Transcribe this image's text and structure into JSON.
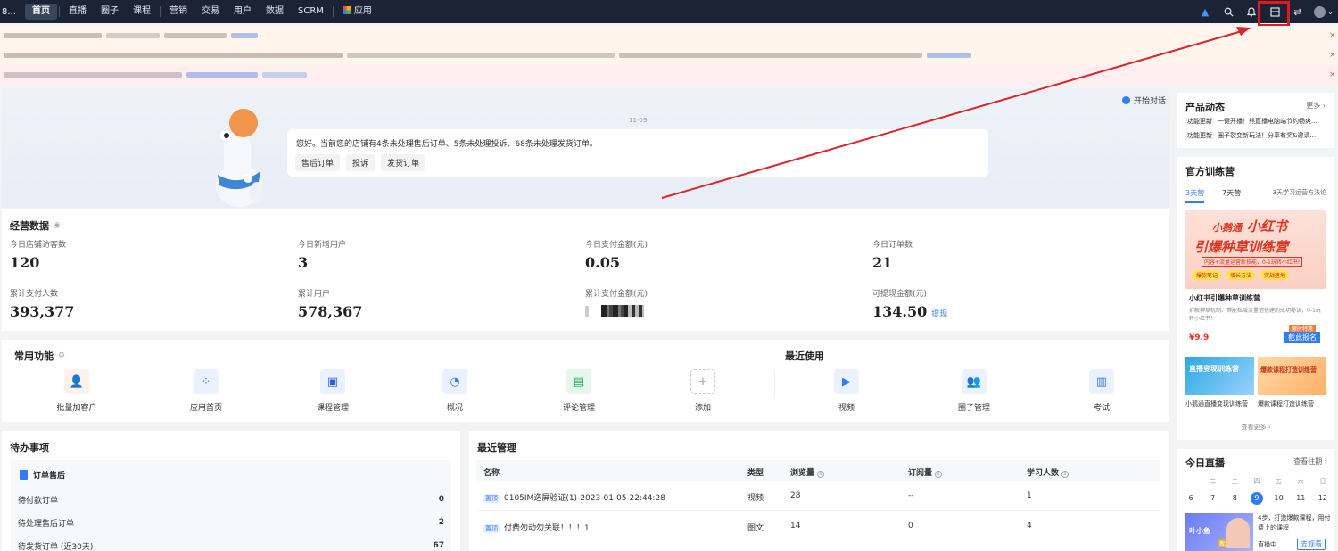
{
  "nav": {
    "brand": "8...",
    "items": [
      "首页",
      "直播",
      "圈子",
      "课程",
      "营销",
      "交易",
      "用户",
      "数据",
      "SCRM"
    ],
    "apps_label": "应用"
  },
  "chat_button": "开始对话",
  "assistant": {
    "date": "11-09",
    "message": "您好。当前您的店铺有4条未处理售后订单、5条未处理投诉、68条未处理发货订单。",
    "chips": [
      "售后订单",
      "投诉",
      "发货订单"
    ]
  },
  "business": {
    "title": "经营数据",
    "stats": [
      {
        "label": "今日店铺访客数",
        "value": "120"
      },
      {
        "label": "今日新增用户",
        "value": "3"
      },
      {
        "label": "今日支付金额(元)",
        "value": "0.05"
      },
      {
        "label": "今日订单数",
        "value": "21"
      },
      {
        "label": "累计支付人数",
        "value": "393,377"
      },
      {
        "label": "累计用户",
        "value": "578,367"
      },
      {
        "label": "累计支付金额(元)",
        "value": ""
      },
      {
        "label": "可提现金额(元)",
        "value": "134.50"
      }
    ],
    "withdraw_link": "提现"
  },
  "common": {
    "title": "常用功能",
    "features": [
      "批量加客户",
      "应用首页",
      "课程管理",
      "概况",
      "评论管理",
      "添加"
    ]
  },
  "recent_used": {
    "title": "最近使用",
    "features": [
      "视频",
      "圈子管理",
      "考试"
    ]
  },
  "todo": {
    "title": "待办事项",
    "group": "订单售后",
    "rows": [
      {
        "label": "待付款订单",
        "value": "0"
      },
      {
        "label": "待处理售后订单",
        "value": "2"
      },
      {
        "label": "待发货订单 (近30天)",
        "value": "67"
      }
    ]
  },
  "recent_manage": {
    "title": "最近管理",
    "headers": [
      "名称",
      "类型",
      "浏览量",
      "订阅量",
      "学习人数"
    ],
    "rows": [
      {
        "tag": "置顶",
        "name": "0105IM迭屏验证(1)-2023-01-05 22:44:28",
        "type": "视频",
        "views": "28",
        "subs": "--",
        "learners": "1"
      },
      {
        "tag": "置顶",
        "name": "付费勿动勿关联！！！1",
        "type": "图文",
        "views": "14",
        "subs": "0",
        "learners": "4"
      }
    ]
  },
  "product_news": {
    "title": "产品动态",
    "more": "更多",
    "items": [
      {
        "tag": "功能更新",
        "text": "一键开播！熊直播电脑端节约畅爽..."
      },
      {
        "tag": "功能更新",
        "text": "圈子裂变新玩法！分享有奖&邀请..."
      }
    ]
  },
  "training": {
    "title": "官方训练营",
    "tabs": [
      "3天营",
      "7天营"
    ],
    "tab_note": "3天学习运营方法论",
    "banner_brand": "小鹅通",
    "banner_title1": "小红书",
    "banner_title2": "引爆种草训练营",
    "banner_sub": "内容+流量运营新技能，0-1玩转小红书!",
    "banner_pills": [
      "爆款笔记",
      "增长方法",
      "实战落地"
    ],
    "course_title": "小红书引爆种草训练营",
    "course_desc": "拆解种草机制、博能私域流量池搭建的成功秘诀，0-1玩转小红书！",
    "price": "¥9.9",
    "badge": "限时特惠",
    "enroll": "截此报名",
    "thumb1_title": "直播变现训练营",
    "thumb1_caption": "小鹅通直播变现训练营",
    "thumb2_title": "爆款课程打造训练营",
    "thumb2_caption": "爆款课程打造训练营",
    "see_more": "查看更多"
  },
  "live_today": {
    "title": "今日直播",
    "history": "查看往期",
    "weekdays": [
      "一",
      "二",
      "三",
      "四",
      "五",
      "六",
      "日"
    ],
    "days": [
      "6",
      "7",
      "8",
      "9",
      "10",
      "11",
      "12"
    ],
    "today_index": 3,
    "card_name": "叶小鱼",
    "card_tag": "教练联盟",
    "card_desc": "4步，打造爆款课程，用付费上的课程",
    "status": "直播中",
    "watch": "去观看"
  },
  "colors": {
    "nav_bg": "#1b2334",
    "accent": "#2f7cf6",
    "annotation": "#e0191e"
  }
}
